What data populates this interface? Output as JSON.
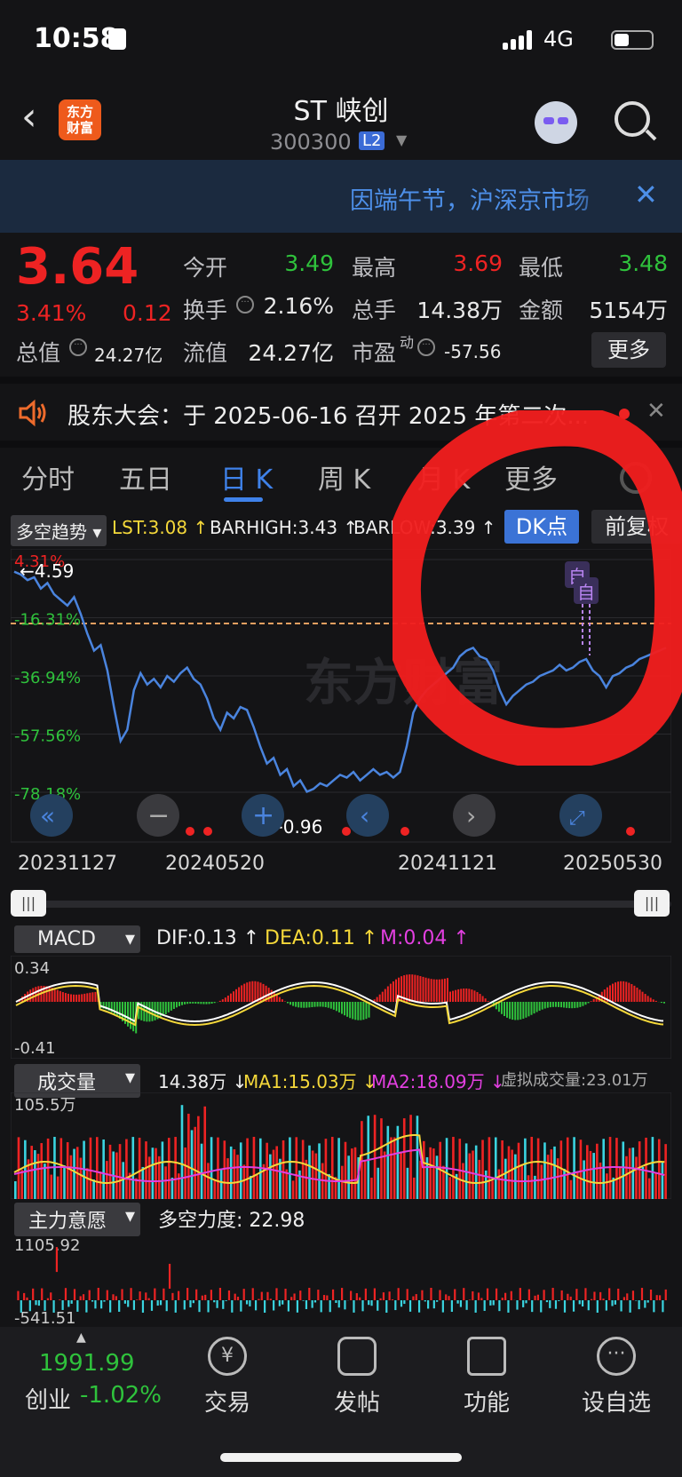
{
  "status_bar": {
    "time": "10:58",
    "network": "4G"
  },
  "header": {
    "stock_name": "ST 峡创",
    "stock_code": "300300",
    "level_badge": "L2",
    "logo_text_line1": "东方",
    "logo_text_line2": "财富"
  },
  "notice": {
    "text": "因端午节，沪深京市场"
  },
  "quote": {
    "price": "3.64",
    "change_pct": "3.41%",
    "change": "0.12",
    "open_label": "今开",
    "open": "3.49",
    "high_label": "最高",
    "high": "3.69",
    "low_label": "最低",
    "low": "3.48",
    "turnover_label": "换手",
    "turnover": "2.16%",
    "volume_label": "总手",
    "volume": "14.38万",
    "amount_label": "金额",
    "amount": "5154万",
    "mktcap_label": "总值",
    "mktcap": "24.27亿",
    "float_label": "流值",
    "float": "24.27亿",
    "pe_label": "市盈",
    "pe_sup": "动",
    "pe": "-57.56",
    "more_label": "更多"
  },
  "announcement": {
    "text": "股东大会：于 2025-06-16 召开 2025 年第二次..."
  },
  "tabs": [
    "分时",
    "五日",
    "日 K",
    "周 K",
    "月 K",
    "更多"
  ],
  "active_tab": 2,
  "main_indicator": {
    "selector": "多空趋势",
    "lst": "LST:3.08",
    "barhigh": "BARHIGH:3.43",
    "barlow": "BARLOW:3.39",
    "dk_button": "DK点",
    "fq_button": "前复权"
  },
  "chart_data": [
    {
      "type": "line",
      "name": "main",
      "y_labels": [
        "4.31%",
        "-16.31%",
        "-36.94%",
        "-57.56%",
        "-78.18%"
      ],
      "ylim": [
        -78.18,
        4.31
      ],
      "max_label": "4.59",
      "min_label": "0.96",
      "marker_text": "自",
      "x_labels": [
        "20231127",
        "20240520",
        "20241121",
        "20250530"
      ],
      "values": [
        0,
        -1,
        -3,
        -2,
        -6,
        -4,
        -8,
        -10,
        -12,
        -9,
        -15,
        -22,
        -28,
        -26,
        -35,
        -48,
        -60,
        -56,
        -42,
        -36,
        -40,
        -38,
        -41,
        -37,
        -39,
        -36,
        -34,
        -38,
        -40,
        -45,
        -52,
        -56,
        -50,
        -52,
        -48,
        -49,
        -55,
        -62,
        -68,
        -66,
        -72,
        -70,
        -76,
        -74,
        -78,
        -77,
        -75,
        -76,
        -74,
        -72,
        -73,
        -71,
        -74,
        -72,
        -70,
        -72,
        -71,
        -73,
        -71,
        -62,
        -50,
        -45,
        -42,
        -40,
        -38,
        -36,
        -34,
        -30,
        -28,
        -27,
        -30,
        -31,
        -35,
        -42,
        -47,
        -44,
        -42,
        -40,
        -39,
        -37,
        -36,
        -35,
        -33,
        -35,
        -34,
        -32,
        -31,
        -35,
        -37,
        -41,
        -37,
        -36,
        -34,
        -33,
        -31,
        -30,
        -29,
        -28,
        -27
      ]
    },
    {
      "type": "line",
      "name": "MACD",
      "y_labels": [
        "0.34",
        "-0.41"
      ],
      "ylim": [
        -0.41,
        0.34
      ]
    },
    {
      "type": "bar",
      "name": "成交量",
      "y_labels": [
        "105.5万"
      ]
    },
    {
      "type": "bar",
      "name": "主力意愿",
      "y_labels": [
        "1105.92",
        "-541.51"
      ]
    }
  ],
  "macd": {
    "selector": "MACD",
    "dif": "DIF:0.13",
    "dea": "DEA:0.11",
    "m": "M:0.04"
  },
  "volume": {
    "selector": "成交量",
    "vol": "14.38万",
    "ma1": "MA1:15.03万",
    "ma2": "MA2:18.09万",
    "virtual": "虚拟成交量:23.01万"
  },
  "power": {
    "selector": "主力意愿",
    "label": "多空力度: 22.98"
  },
  "watermark": "东方财富",
  "bottom_nav": {
    "index_value": "1991.99",
    "index_name": "创业",
    "index_change": "-1.02%",
    "items": [
      "交易",
      "发帖",
      "功能",
      "设自选"
    ]
  },
  "colors": {
    "up": "#ee2323",
    "down": "#2fc23c",
    "accent": "#3f82ea",
    "line": "#4a84de"
  }
}
